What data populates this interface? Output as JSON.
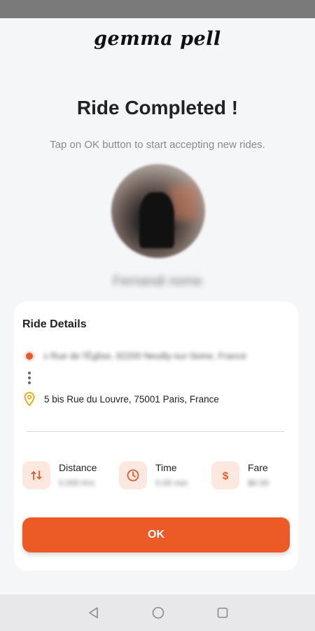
{
  "brand": "gemma pell",
  "title": "Ride Completed !",
  "subtitle": "Tap on OK button to start accepting new rides.",
  "user": {
    "name": "Fernandi nome"
  },
  "ride_details": {
    "title": "Ride Details",
    "pickup_address": "x Rue de l'Église, 92200 Neuilly-sur-Seine, France",
    "drop_address": "5 bis Rue du Louvre, 75001 Paris, France",
    "stats": [
      {
        "label": "Distance",
        "value": "0.000 Km",
        "icon": "route-icon"
      },
      {
        "label": "Time",
        "value": "0.00 min",
        "icon": "clock-icon"
      },
      {
        "label": "Fare",
        "value": "$0.00",
        "icon": "dollar-icon"
      }
    ]
  },
  "ok_label": "OK",
  "colors": {
    "accent": "#ec5a26",
    "accent_soft": "#fde8e0",
    "pin": "#f0a500"
  },
  "nav": {
    "icons": [
      "back-icon",
      "home-icon",
      "recents-icon"
    ]
  }
}
